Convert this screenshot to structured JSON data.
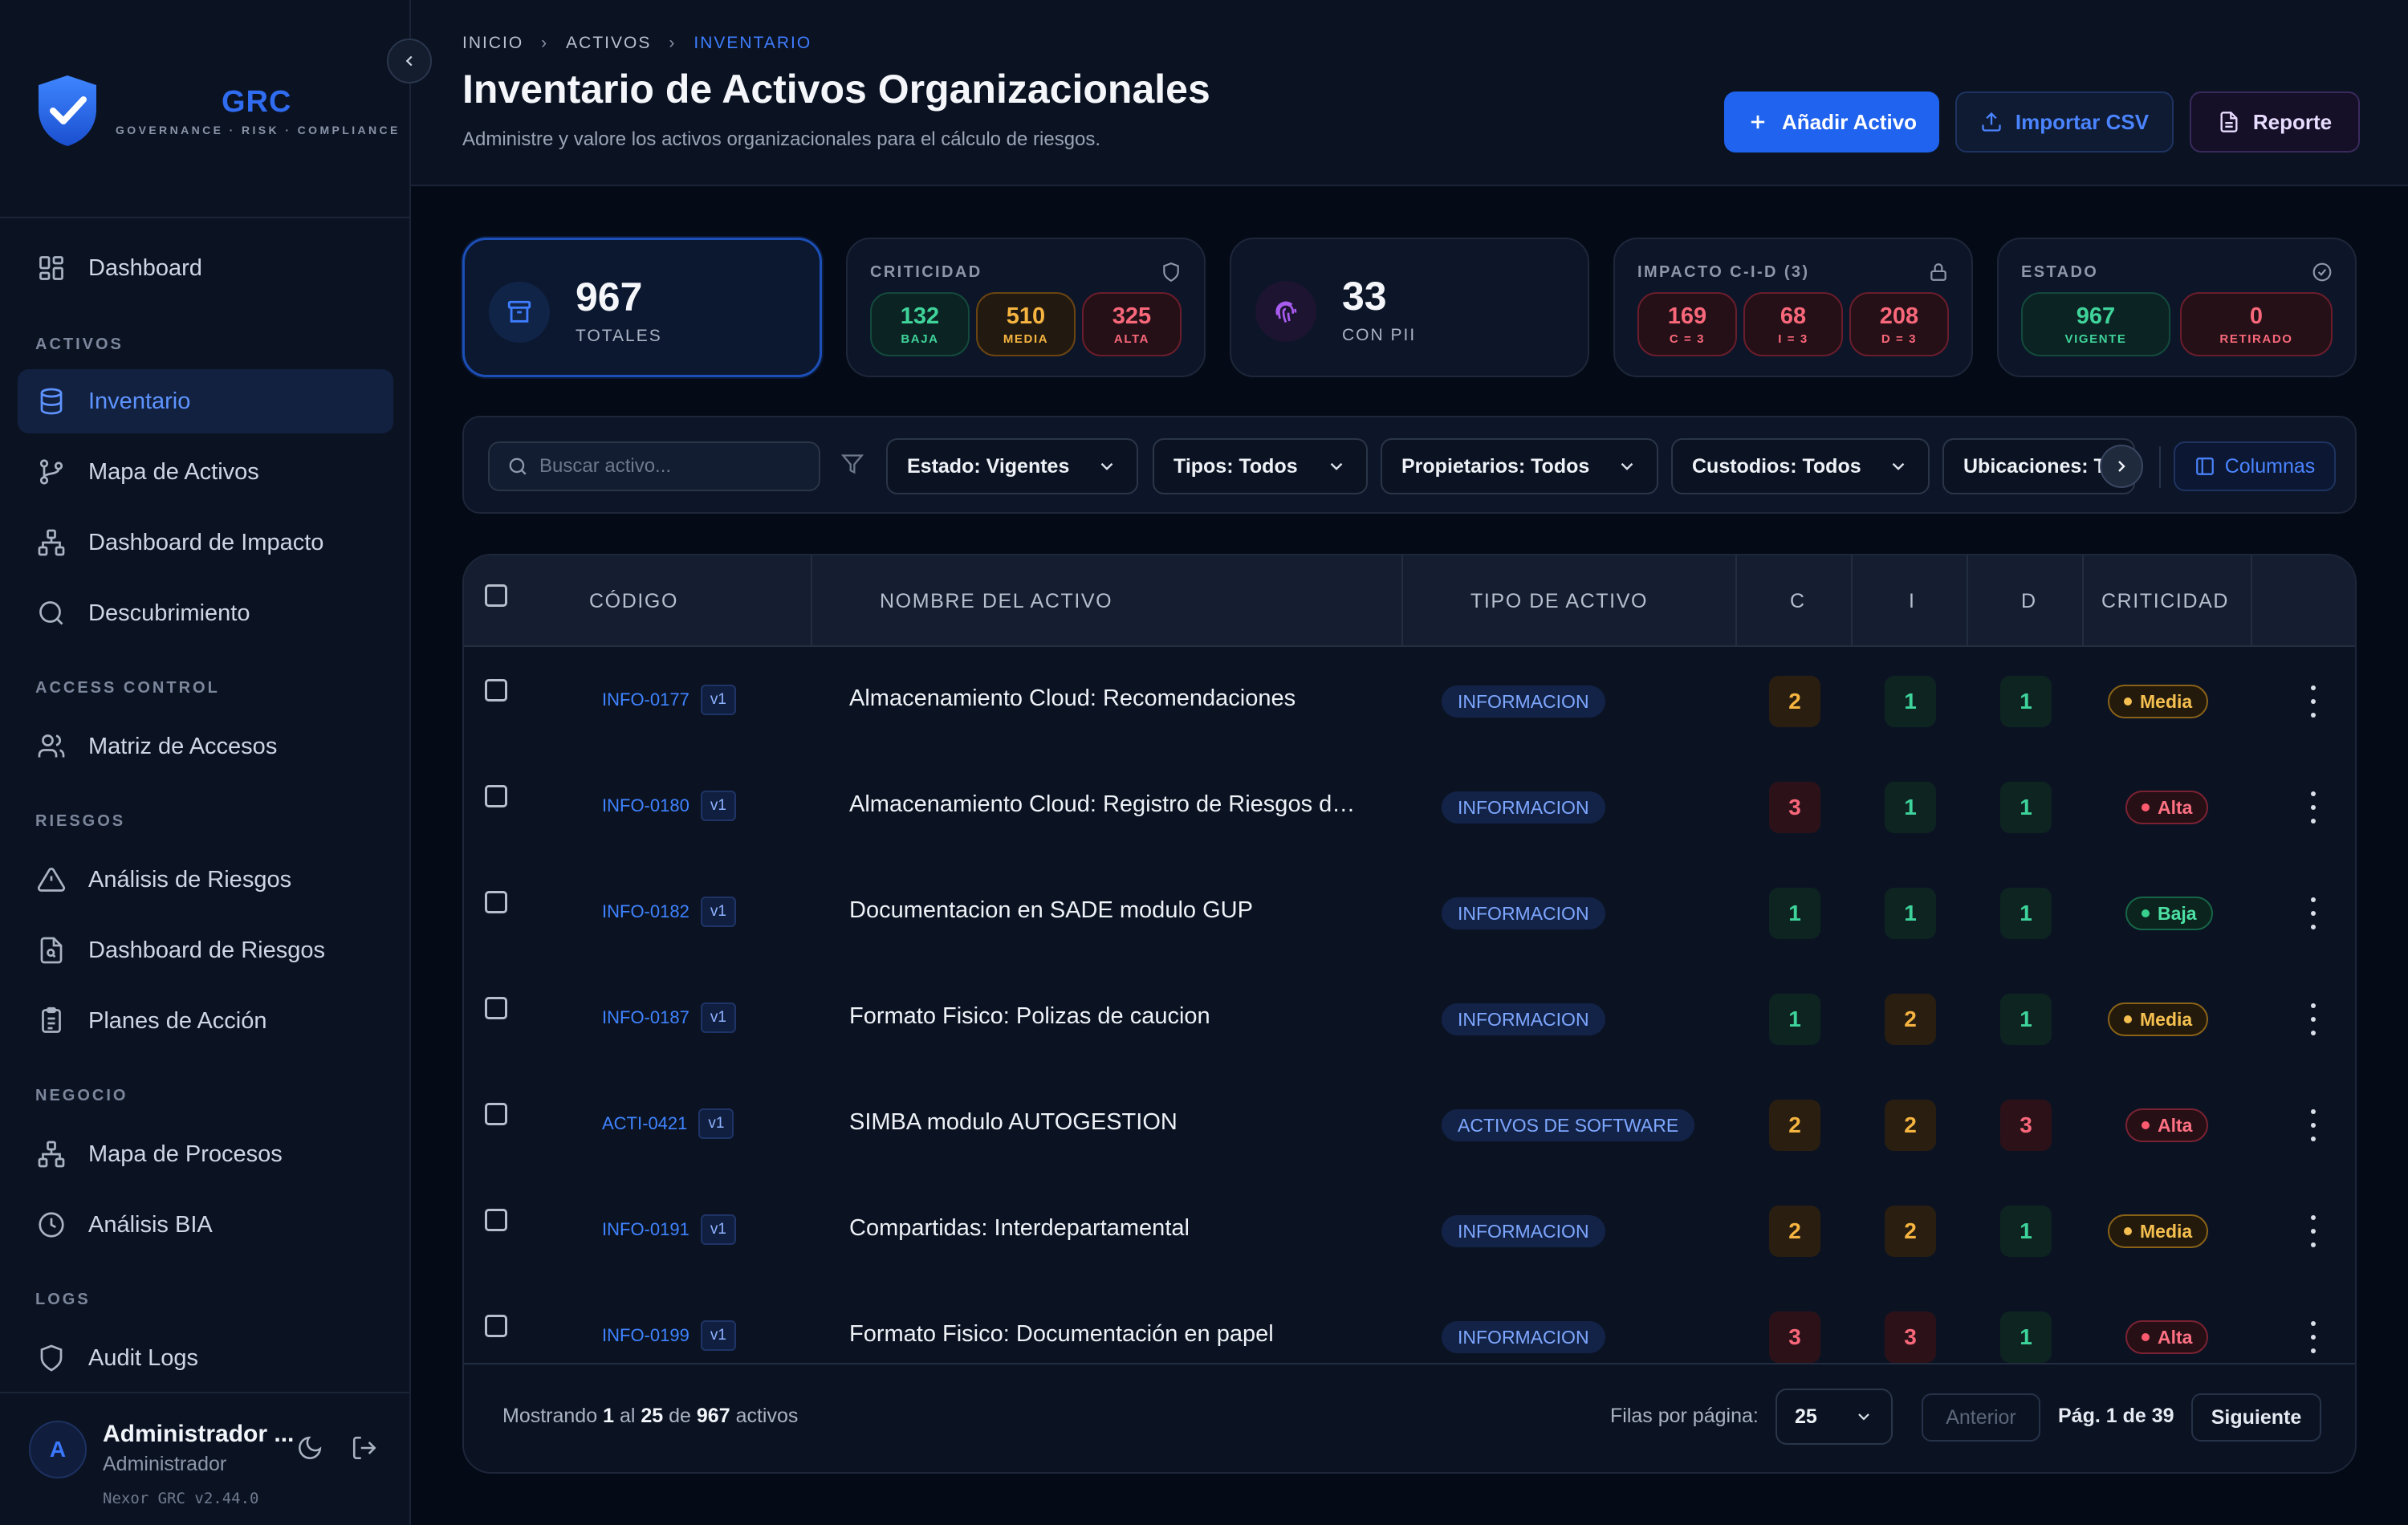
{
  "sidebar": {
    "logo_title": "GRC",
    "logo_subtitle": "GOVERNANCE · RISK · COMPLIANCE",
    "sections": {
      "activos": "ACTIVOS",
      "access": "ACCESS CONTROL",
      "riesgos": "RIESGOS",
      "negocio": "NEGOCIO",
      "logs": "LOGS"
    },
    "items": {
      "dashboard": "Dashboard",
      "inventario": "Inventario",
      "mapa_activos": "Mapa de Activos",
      "dashboard_impacto": "Dashboard de Impacto",
      "descubrimiento": "Descubrimiento",
      "matriz_accesos": "Matriz de Accesos",
      "analisis_riesgos": "Análisis de Riesgos",
      "dashboard_riesgos": "Dashboard de Riesgos",
      "planes_accion": "Planes de Acción",
      "mapa_procesos": "Mapa de Procesos",
      "analisis_bia": "Análisis BIA",
      "audit_logs": "Audit Logs"
    },
    "user": {
      "initial": "A",
      "name": "Administrador ...",
      "role": "Administrador",
      "version": "Nexor GRC v2.44.0"
    }
  },
  "header": {
    "breadcrumb": [
      "INICIO",
      "ACTIVOS",
      "INVENTARIO"
    ],
    "title": "Inventario de Activos Organizacionales",
    "subtitle": "Administre y valore los activos organizacionales para el cálculo de riesgos.",
    "buttons": {
      "add": "Añadir Activo",
      "import": "Importar CSV",
      "report": "Reporte"
    }
  },
  "stats": {
    "total": {
      "value": "967",
      "label": "TOTALES"
    },
    "criticidad": {
      "title": "CRITICIDAD",
      "baja": "132",
      "baja_label": "BAJA",
      "media": "510",
      "media_label": "MEDIA",
      "alta": "325",
      "alta_label": "ALTA"
    },
    "pii": {
      "value": "33",
      "label": "CON PII"
    },
    "impacto": {
      "title": "IMPACTO C-I-D (3)",
      "c": "169",
      "c_label": "C = 3",
      "i": "68",
      "i_label": "I = 3",
      "d": "208",
      "d_label": "D = 3"
    },
    "estado": {
      "title": "ESTADO",
      "vigente": "967",
      "vigente_label": "VIGENTE",
      "retirado": "0",
      "retirado_label": "RETIRADO"
    }
  },
  "filters": {
    "search_placeholder": "Buscar activo...",
    "estado": "Estado: Vigentes",
    "tipos": "Tipos: Todos",
    "propietarios": "Propietarios: Todos",
    "custodios": "Custodios: Todos",
    "ubicaciones": "Ubicaciones: T",
    "columns": "Columnas"
  },
  "table": {
    "headers": {
      "codigo": "CÓDIGO",
      "nombre": "NOMBRE DEL ACTIVO",
      "tipo": "TIPO DE ACTIVO",
      "c": "C",
      "i": "I",
      "d": "D",
      "criticidad": "CRITICIDAD"
    },
    "rows": [
      {
        "code": "INFO-0177",
        "version": "v1",
        "name": "Almacenamiento Cloud: Recomendaciones",
        "type": "INFORMACION",
        "c": "2",
        "i": "1",
        "d": "1",
        "criticidad": "Media"
      },
      {
        "code": "INFO-0180",
        "version": "v1",
        "name": "Almacenamiento Cloud: Registro de Riesgos de...",
        "type": "INFORMACION",
        "c": "3",
        "i": "1",
        "d": "1",
        "criticidad": "Alta"
      },
      {
        "code": "INFO-0182",
        "version": "v1",
        "name": "Documentacion en SADE modulo GUP",
        "type": "INFORMACION",
        "c": "1",
        "i": "1",
        "d": "1",
        "criticidad": "Baja"
      },
      {
        "code": "INFO-0187",
        "version": "v1",
        "name": "Formato Fisico: Polizas de caucion",
        "type": "INFORMACION",
        "c": "1",
        "i": "2",
        "d": "1",
        "criticidad": "Media"
      },
      {
        "code": "ACTI-0421",
        "version": "v1",
        "name": "SIMBA modulo AUTOGESTION",
        "type": "ACTIVOS DE SOFTWARE",
        "c": "2",
        "i": "2",
        "d": "3",
        "criticidad": "Alta"
      },
      {
        "code": "INFO-0191",
        "version": "v1",
        "name": "Compartidas: Interdepartamental",
        "type": "INFORMACION",
        "c": "2",
        "i": "2",
        "d": "1",
        "criticidad": "Media"
      },
      {
        "code": "INFO-0199",
        "version": "v1",
        "name": "Formato Fisico: Documentación en papel",
        "type": "INFORMACION",
        "c": "3",
        "i": "3",
        "d": "1",
        "criticidad": "Alta"
      }
    ]
  },
  "footer": {
    "showing_prefix": "Mostrando",
    "showing_from": "1",
    "showing_mid": "al",
    "showing_to": "25",
    "showing_de": "de",
    "showing_total": "967",
    "showing_suffix": "activos",
    "rows_per_page_label": "Filas por página:",
    "rows_per_page": "25",
    "prev": "Anterior",
    "page_info": "Pág. 1 de 39",
    "next": "Siguiente"
  },
  "colors": {
    "accent": "#1f63ee",
    "background": "#050a17",
    "level_low": "#3ed39b",
    "level_mid": "#f6b440",
    "level_high": "#f8677a"
  }
}
